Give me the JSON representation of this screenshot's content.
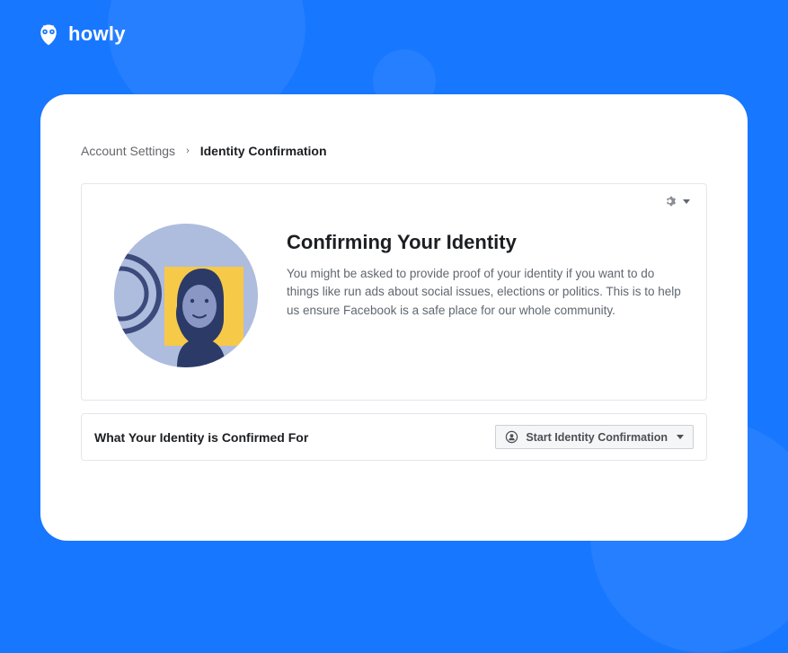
{
  "brand": {
    "name": "howly"
  },
  "breadcrumb": {
    "parent": "Account Settings",
    "separator": "›",
    "current": "Identity Confirmation"
  },
  "card": {
    "title": "Confirming Your Identity",
    "description": "You might be asked to provide proof of your identity if you want to do things like run ads about social issues, elections or politics. This is to help us ensure Facebook is a safe place for our whole community."
  },
  "section": {
    "label": "What Your Identity is Confirmed For",
    "button_label": "Start Identity Confirmation"
  }
}
